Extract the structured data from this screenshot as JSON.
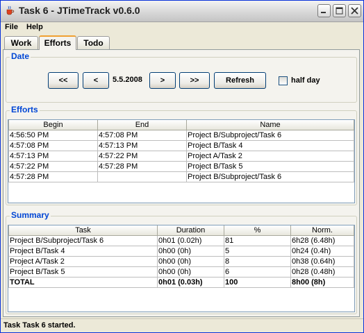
{
  "window": {
    "title": "Task 6 - JTimeTrack v0.6.0"
  },
  "menu": [
    "File",
    "Help"
  ],
  "tabs": [
    "Work",
    "Efforts",
    "Todo"
  ],
  "active_tab": "Efforts",
  "date_section": {
    "title": "Date",
    "first_label": "<<",
    "prev_label": "<",
    "date_value": "5.5.2008",
    "next_label": ">",
    "last_label": ">>",
    "refresh_label": "Refresh",
    "half_day_label": "half day",
    "half_day_checked": false
  },
  "efforts": {
    "title": "Efforts",
    "columns": [
      "Begin",
      "End",
      "Name"
    ],
    "rows": [
      [
        "4:56:50 PM",
        "4:57:08 PM",
        "Project B/Subproject/Task 6"
      ],
      [
        "4:57:08 PM",
        "4:57:13 PM",
        "Project B/Task 4"
      ],
      [
        "4:57:13 PM",
        "4:57:22 PM",
        "Project A/Task 2"
      ],
      [
        "4:57:22 PM",
        "4:57:28 PM",
        "Project B/Task 5"
      ],
      [
        "4:57:28 PM",
        "",
        "Project B/Subproject/Task 6"
      ]
    ]
  },
  "summary": {
    "title": "Summary",
    "columns": [
      "Task",
      "Duration",
      "%",
      "Norm."
    ],
    "rows": [
      [
        "Project B/Subproject/Task 6",
        "0h01 (0.02h)",
        "81",
        "6h28 (6.48h)"
      ],
      [
        "Project B/Task 4",
        "0h00 (0h)",
        "5",
        "0h24 (0.4h)"
      ],
      [
        "Project A/Task 2",
        "0h00 (0h)",
        "8",
        "0h38 (0.64h)"
      ],
      [
        "Project B/Task 5",
        "0h00 (0h)",
        "6",
        "0h28 (0.48h)"
      ]
    ],
    "total": [
      "TOTAL",
      "0h01 (0.03h)",
      "100",
      "8h00 (8h)"
    ]
  },
  "status": "Task Task 6 started."
}
